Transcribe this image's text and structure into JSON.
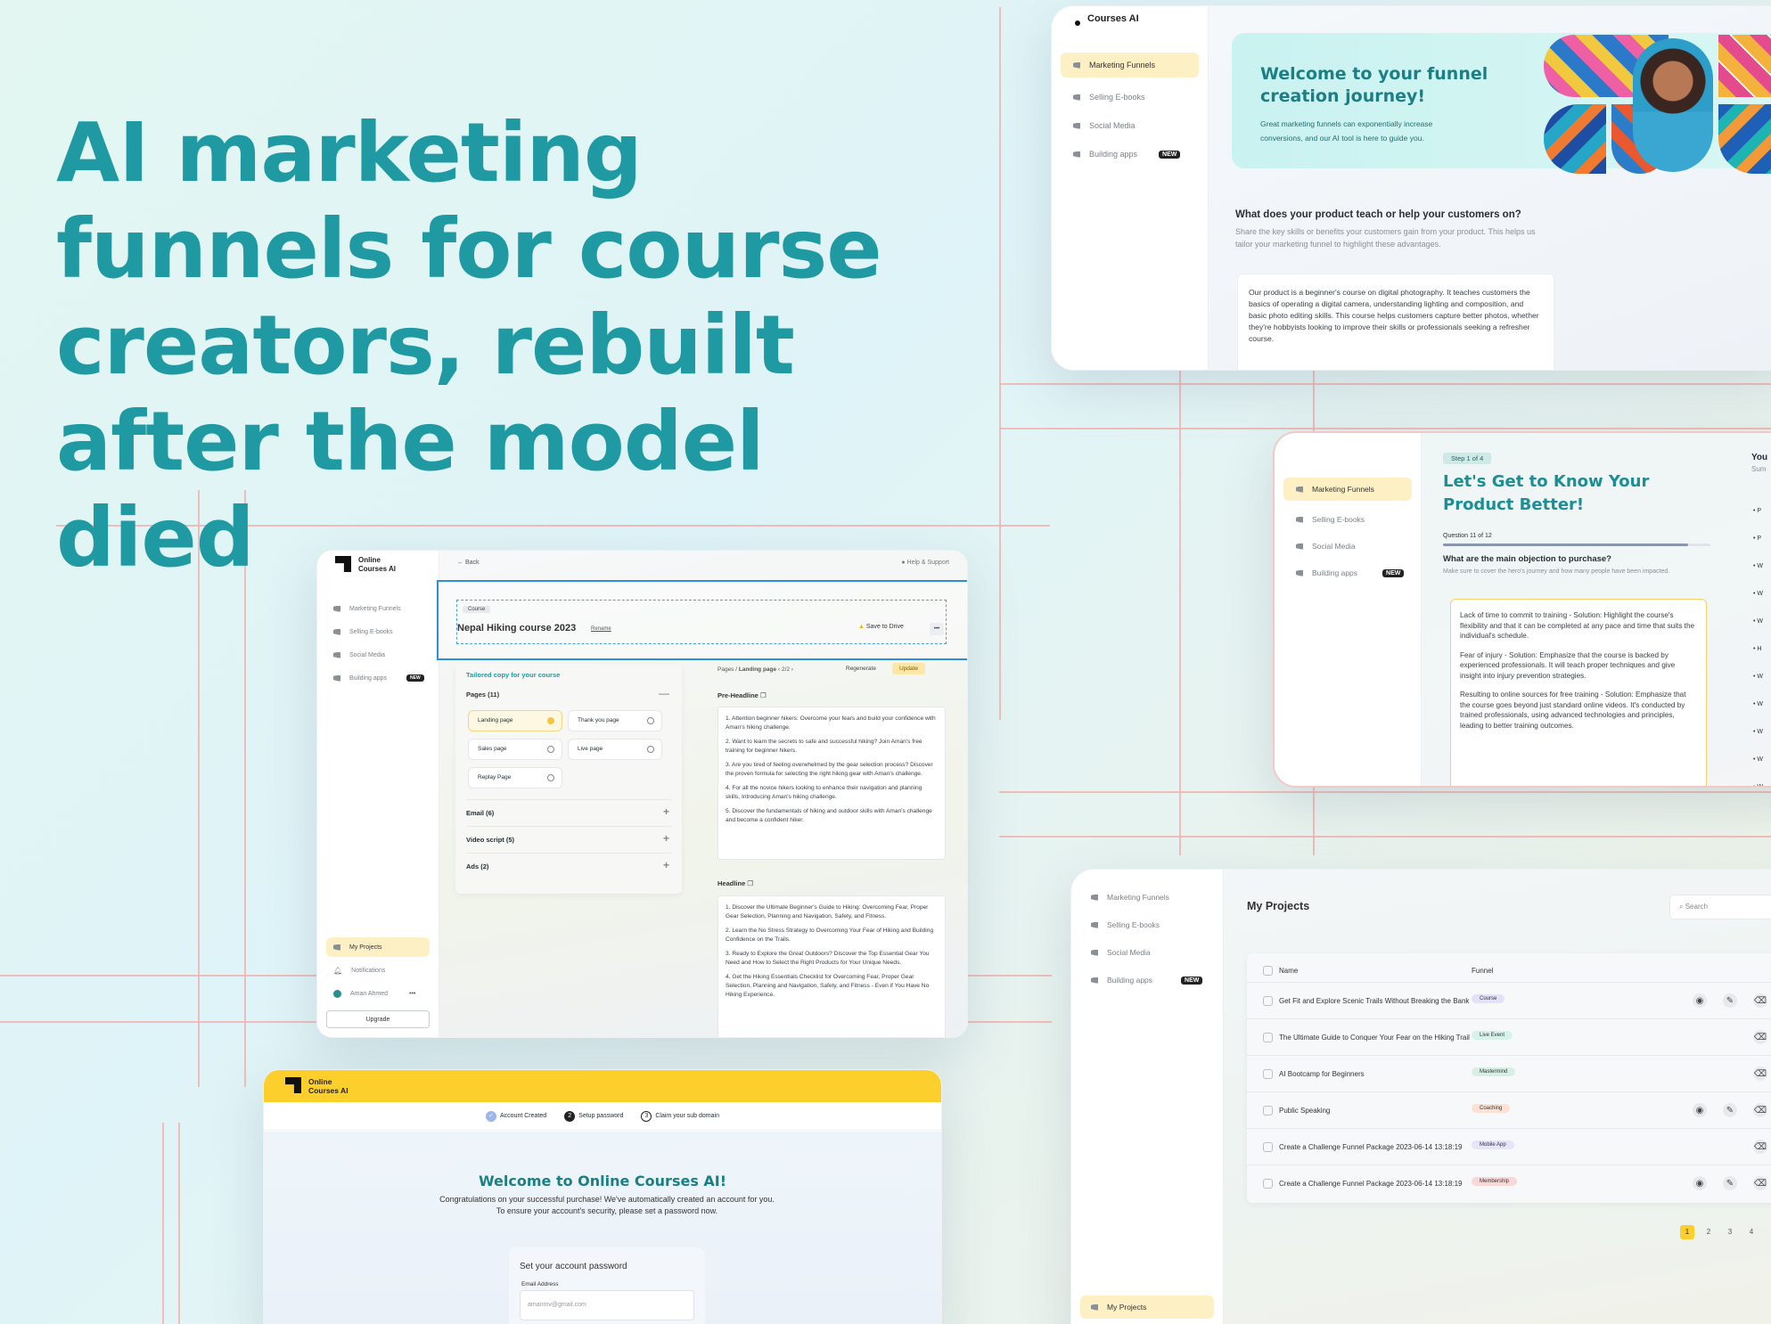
{
  "hero": {
    "title": "AI marketing funnels for course creators, rebuilt after the model died"
  },
  "w1": {
    "brand": "Courses AI",
    "nav": [
      {
        "label": "Marketing Funnels"
      },
      {
        "label": "Selling E-books"
      },
      {
        "label": "Social Media"
      },
      {
        "label": "Building apps"
      }
    ],
    "new_badge": "NEW",
    "welcome_title": "Welcome to your funnel creation journey!",
    "welcome_text": "Great marketing funnels can exponentially increase conversions, and our AI tool is here to guide you.",
    "question": "What does your product teach or help your customers on?",
    "hint": "Share the key skills or benefits your customers gain from your product. This helps us tailor your marketing funnel to highlight these advantages.",
    "answer": "Our product is a beginner's course on digital photography. It teaches customers the basics of operating a digital camera, understanding lighting and composition, and basic photo editing skills. This course helps customers capture better photos, whether they're hobbyists looking to improve their skills or professionals seeking a refresher course.",
    "accent": "#1b7f86"
  },
  "w2": {
    "nav": [
      {
        "label": "Marketing Funnels"
      },
      {
        "label": "Selling E-books"
      },
      {
        "label": "Social Media"
      },
      {
        "label": "Building apps"
      }
    ],
    "new_badge": "NEW",
    "step": "Step 1 of 4",
    "title": "Let's Get to Know Your Product Better!",
    "question_counter": "Question 11 of 12",
    "question_progress": 0.917,
    "question": "What are the main objection to purchase?",
    "hint": "Make sure to cover the hero's journey and how many people have been impacted.",
    "answers": [
      "Lack of time to commit to training - Solution: Highlight the course's flexibility and that it can be completed at any pace and time that suits the individual's schedule.",
      "Fear of injury - Solution: Emphasize that the course is backed by experienced professionals. It will teach proper techniques and give insight into injury prevention strategies.",
      "Resulting to online sources for free training - Solution: Emphasize that the course goes beyond just standard online videos. It's conducted by trained professionals, using advanced technologies and principles, leading to better training outcomes."
    ],
    "right_title": "You",
    "right_sub": "Sum",
    "right_bullets": [
      "P",
      "P",
      "W",
      "W",
      "W",
      "H",
      "W",
      "W",
      "W",
      "W",
      "W"
    ]
  },
  "w3": {
    "brand_line1": "Online",
    "brand_line2": "Courses AI",
    "nav": [
      {
        "label": "Marketing Funnels"
      },
      {
        "label": "Selling E-books"
      },
      {
        "label": "Social Media"
      },
      {
        "label": "Building apps"
      }
    ],
    "new_badge": "NEW",
    "bottom_nav": [
      {
        "label": "My Projects"
      },
      {
        "label": "Notifications"
      },
      {
        "label": "Aman Ahmed"
      }
    ],
    "upgrade": "Upgrade",
    "back": "Back",
    "help": "Help & Support",
    "course_tag": "Course",
    "course_title": "Nepal Hiking course 2023",
    "rename": "Rename",
    "save_drive": "Save to Drive",
    "more": "•••",
    "tailored": "Tailored copy for your course",
    "pages_label": "Pages (11)",
    "pages": [
      {
        "label": "Landing page"
      },
      {
        "label": "Thank you page"
      },
      {
        "label": "Sales page"
      },
      {
        "label": "Live page"
      },
      {
        "label": "Replay Page"
      }
    ],
    "sections": [
      {
        "label": "Email (6)"
      },
      {
        "label": "Video script (5)"
      },
      {
        "label": "Ads (2)"
      }
    ],
    "crumb_pages": "Pages",
    "crumb_sep": "/",
    "crumb_current": "Landing page",
    "crumb_pager": "‹  2/2  ›",
    "regenerate": "Regenerate",
    "update": "Update",
    "pre_headline_label": "Pre-Headline",
    "pre_headline": [
      "1. Attention beginner hikers: Overcome your fears and build your confidence with Aman's hiking challenge.",
      "2. Want to learn the secrets to safe and successful hiking? Join Aman's free training for beginner hikers.",
      "3. Are you tired of feeling overwhelmed by the gear selection process? Discover the proven formula for selecting the right hiking gear with Aman's challenge.",
      "4. For all the novice hikers looking to enhance their navigation and planning skills, Introducing Aman's hiking challenge.",
      "5. Discover the fundamentals of hiking and outdoor skills with Aman's challenge and become a confident hiker."
    ],
    "headline_label": "Headline",
    "headline": [
      "1. Discover the Ultimate Beginner's Guide to Hiking: Overcoming Fear, Proper Gear Selection, Planning and Navigation, Safety, and Fitness.",
      "2. Learn the No Stress Strategy to Overcoming Your Fear of Hiking and Building Confidence on the Trails.",
      "3. Ready to Explore the Great Outdoors? Discover the Top Essential Gear You Need and How to Select the Right Products for Your Unique Needs.",
      "4. Get the Hiking Essentials Checklist for Overcoming Fear, Proper Gear Selection, Planning and Navigation, Safety, and Fitness - Even if You Have No Hiking Experience."
    ],
    "selection_color": "#2f8fd6"
  },
  "w4": {
    "brand_line1": "Online",
    "brand_line2": "Courses AI",
    "steps": [
      {
        "label": "Account Created",
        "marker": "✓"
      },
      {
        "label": "Setup password",
        "marker": "2"
      },
      {
        "label": "Claim your sub domain",
        "marker": "3"
      }
    ],
    "title": "Welcome to Online Courses AI!",
    "text": "Congratulations on your successful purchase! We've automatically created an account for you. To ensure your account's security, please set a password now.",
    "form_title": "Set your account password",
    "email_label": "Email Address",
    "email_value": "amanmv@gmail.com",
    "header_color": "#fccf2c"
  },
  "w5": {
    "nav": [
      {
        "label": "Marketing Funnels"
      },
      {
        "label": "Selling E-books"
      },
      {
        "label": "Social Media"
      },
      {
        "label": "Building apps"
      }
    ],
    "new_badge": "NEW",
    "title": "My Projects",
    "search_placeholder": "Search",
    "col_name": "Name",
    "col_funnel": "Funnel",
    "rows": [
      {
        "name": "Get Fit and Explore Scenic Trails Without Breaking the Bank",
        "funnel": "Course",
        "color": "#e4e0fb"
      },
      {
        "name": "The Ultimate Guide to Conquer Your Fear on the Hiking Trail",
        "funnel": "Live Event",
        "color": "#d6f3ea"
      },
      {
        "name": "AI Bootcamp for Beginners",
        "funnel": "Mastermind",
        "color": "#d7f0e4"
      },
      {
        "name": "Public Speaking",
        "funnel": "Coaching",
        "color": "#fde2d4"
      },
      {
        "name": "Create a Challenge Funnel Package 2023-06-14 13:18:19",
        "funnel": "Mobile App",
        "color": "#e6e3fb"
      },
      {
        "name": "Create a Challenge Funnel Package 2023-06-14 13:18:19",
        "funnel": "Membership",
        "color": "#fbd8d8"
      }
    ],
    "pages": [
      "1",
      "2",
      "3",
      "4"
    ],
    "active_page": "1",
    "bottom": "My Projects"
  }
}
